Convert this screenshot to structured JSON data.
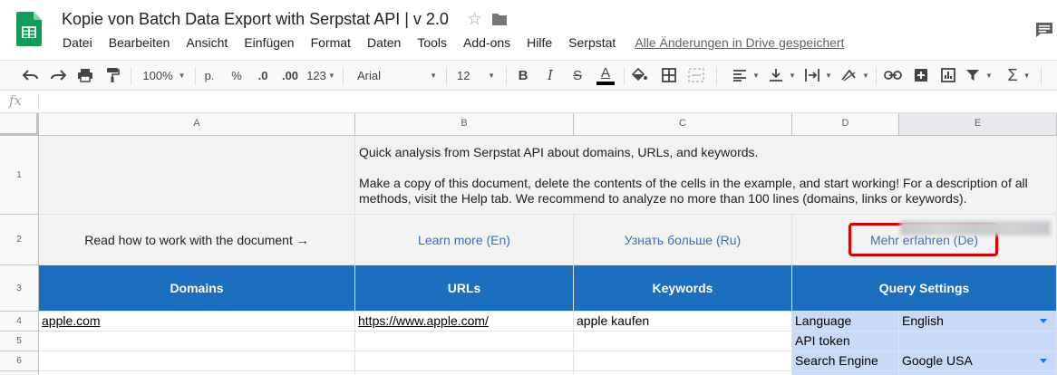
{
  "app": {
    "title": "Kopie von Batch Data Export with Serpstat API |  v 2.0",
    "save_status": "Alle Änderungen in Drive gespeichert"
  },
  "menu": [
    "Datei",
    "Bearbeiten",
    "Ansicht",
    "Einfügen",
    "Format",
    "Daten",
    "Tools",
    "Add-ons",
    "Hilfe",
    "Serpstat"
  ],
  "toolbar": {
    "zoom": "100%",
    "currency": "p.",
    "percent": "%",
    "decrease_decimals": ".0",
    "increase_decimals": ".00",
    "more_formats": "123",
    "font": "Arial",
    "font_size": "12",
    "bold": "B",
    "italic": "I",
    "strikethrough": "S",
    "text_color": "A",
    "functions": "Σ",
    "colors": {
      "text_color_bar": "#000000",
      "toolbar_bg": "#f8f9fa"
    }
  },
  "formula_bar": {
    "label": "fx",
    "value": ""
  },
  "columns": [
    "A",
    "B",
    "C",
    "D",
    "E"
  ],
  "rows": [
    "1",
    "2",
    "3",
    "4",
    "5",
    "6"
  ],
  "cells": {
    "intro_line1": "Quick analysis from Serpstat API about domains, URLs, and keywords.",
    "intro_line2": "Make a copy of this document, delete the contents of the cells in the example, and start working! For a description of all methods, visit the Help tab. We recommend to analyze no more than 100 lines (domains, links or keywords).",
    "read_how": "Read how to work with the document →",
    "learn_more_en": "Learn more (En)",
    "learn_more_ru": "Узнать больше (Ru)",
    "learn_more_de": "Mehr erfahren (De)",
    "hdr_domains": "Domains",
    "hdr_urls": "URLs",
    "hdr_keywords": "Keywords",
    "hdr_query_settings": "Query Settings",
    "domain_1": "apple.com",
    "url_1": "https://www.apple.com/",
    "keyword_1": "apple kaufen",
    "setting_language_label": "Language",
    "setting_language_value": "English",
    "setting_token_label": "API token",
    "setting_engine_label": "Search Engine",
    "setting_engine_value": "Google USA"
  },
  "colors": {
    "header_blue": "#1c6fbf",
    "settings_blue": "#c9daf8",
    "link_blue": "#3c6db6",
    "highlight_red": "#d50000",
    "gray_fill": "#f3f3f3"
  }
}
